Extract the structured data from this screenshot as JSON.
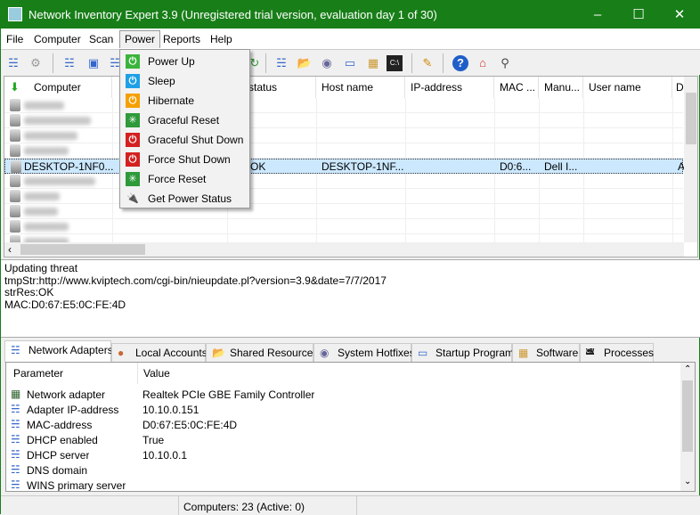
{
  "window": {
    "title": "Network Inventory Expert 3.9 (Unregistered trial version, evaluation day 1 of 30)",
    "accent": "#187e18"
  },
  "menubar": [
    "File",
    "Computer",
    "Scan",
    "Power",
    "Reports",
    "Help"
  ],
  "power_menu": [
    {
      "label": "Power Up",
      "icon": "power-up-icon",
      "color": "#3cb43c"
    },
    {
      "label": "Sleep",
      "icon": "sleep-icon",
      "color": "#1ea0e6"
    },
    {
      "label": "Hibernate",
      "icon": "hibernate-icon",
      "color": "#f5a000"
    },
    {
      "label": "Graceful Reset",
      "icon": "graceful-reset-icon",
      "color": "#2e9a3a"
    },
    {
      "label": "Graceful Shut Down",
      "icon": "graceful-shutdown-icon",
      "color": "#d42020"
    },
    {
      "label": "Force Shut Down",
      "icon": "force-shutdown-icon",
      "color": "#d42020"
    },
    {
      "label": "Force Reset",
      "icon": "force-reset-icon",
      "color": "#2e9a3a"
    },
    {
      "label": "Get Power Status",
      "icon": "plug-icon",
      "color": "#555577"
    }
  ],
  "computers": {
    "columns": [
      "Computer",
      "n status",
      "Host name",
      "IP-address",
      "MAC ...",
      "Manu...",
      "User name",
      "D"
    ],
    "selected_row": {
      "computer": "DESKTOP-1NF0...",
      "status": "OK",
      "host": "DESKTOP-1NF...",
      "ip": "",
      "mac": "D0:6...",
      "manufacturer": "Dell I...",
      "user": "",
      "d": "A"
    }
  },
  "log": [
    "Updating threat",
    "tmpStr:http://www.kviptech.com/cgi-bin/nieupdate.pl?version=3.9&date=7/7/2017",
    "strRes:OK",
    "MAC:D0:67:E5:0C:FE:4D"
  ],
  "tabs": [
    "Network Adapters",
    "Local Accounts",
    "Shared Resources",
    "System Hotfixes",
    "Startup Programs",
    "Software",
    "Processes"
  ],
  "details": {
    "columns": [
      "Parameter",
      "Value"
    ],
    "rows": [
      {
        "param": "Network adapter",
        "value": "Realtek PCIe GBE Family Controller"
      },
      {
        "param": "Adapter IP-address",
        "value": "10.10.0.151"
      },
      {
        "param": "MAC-address",
        "value": "D0:67:E5:0C:FE:4D"
      },
      {
        "param": "DHCP enabled",
        "value": "True"
      },
      {
        "param": "DHCP server",
        "value": "10.10.0.1"
      },
      {
        "param": "DNS domain",
        "value": ""
      },
      {
        "param": "WINS primary server",
        "value": ""
      }
    ]
  },
  "status": {
    "computers": "Computers: 23 (Active: 0)"
  }
}
